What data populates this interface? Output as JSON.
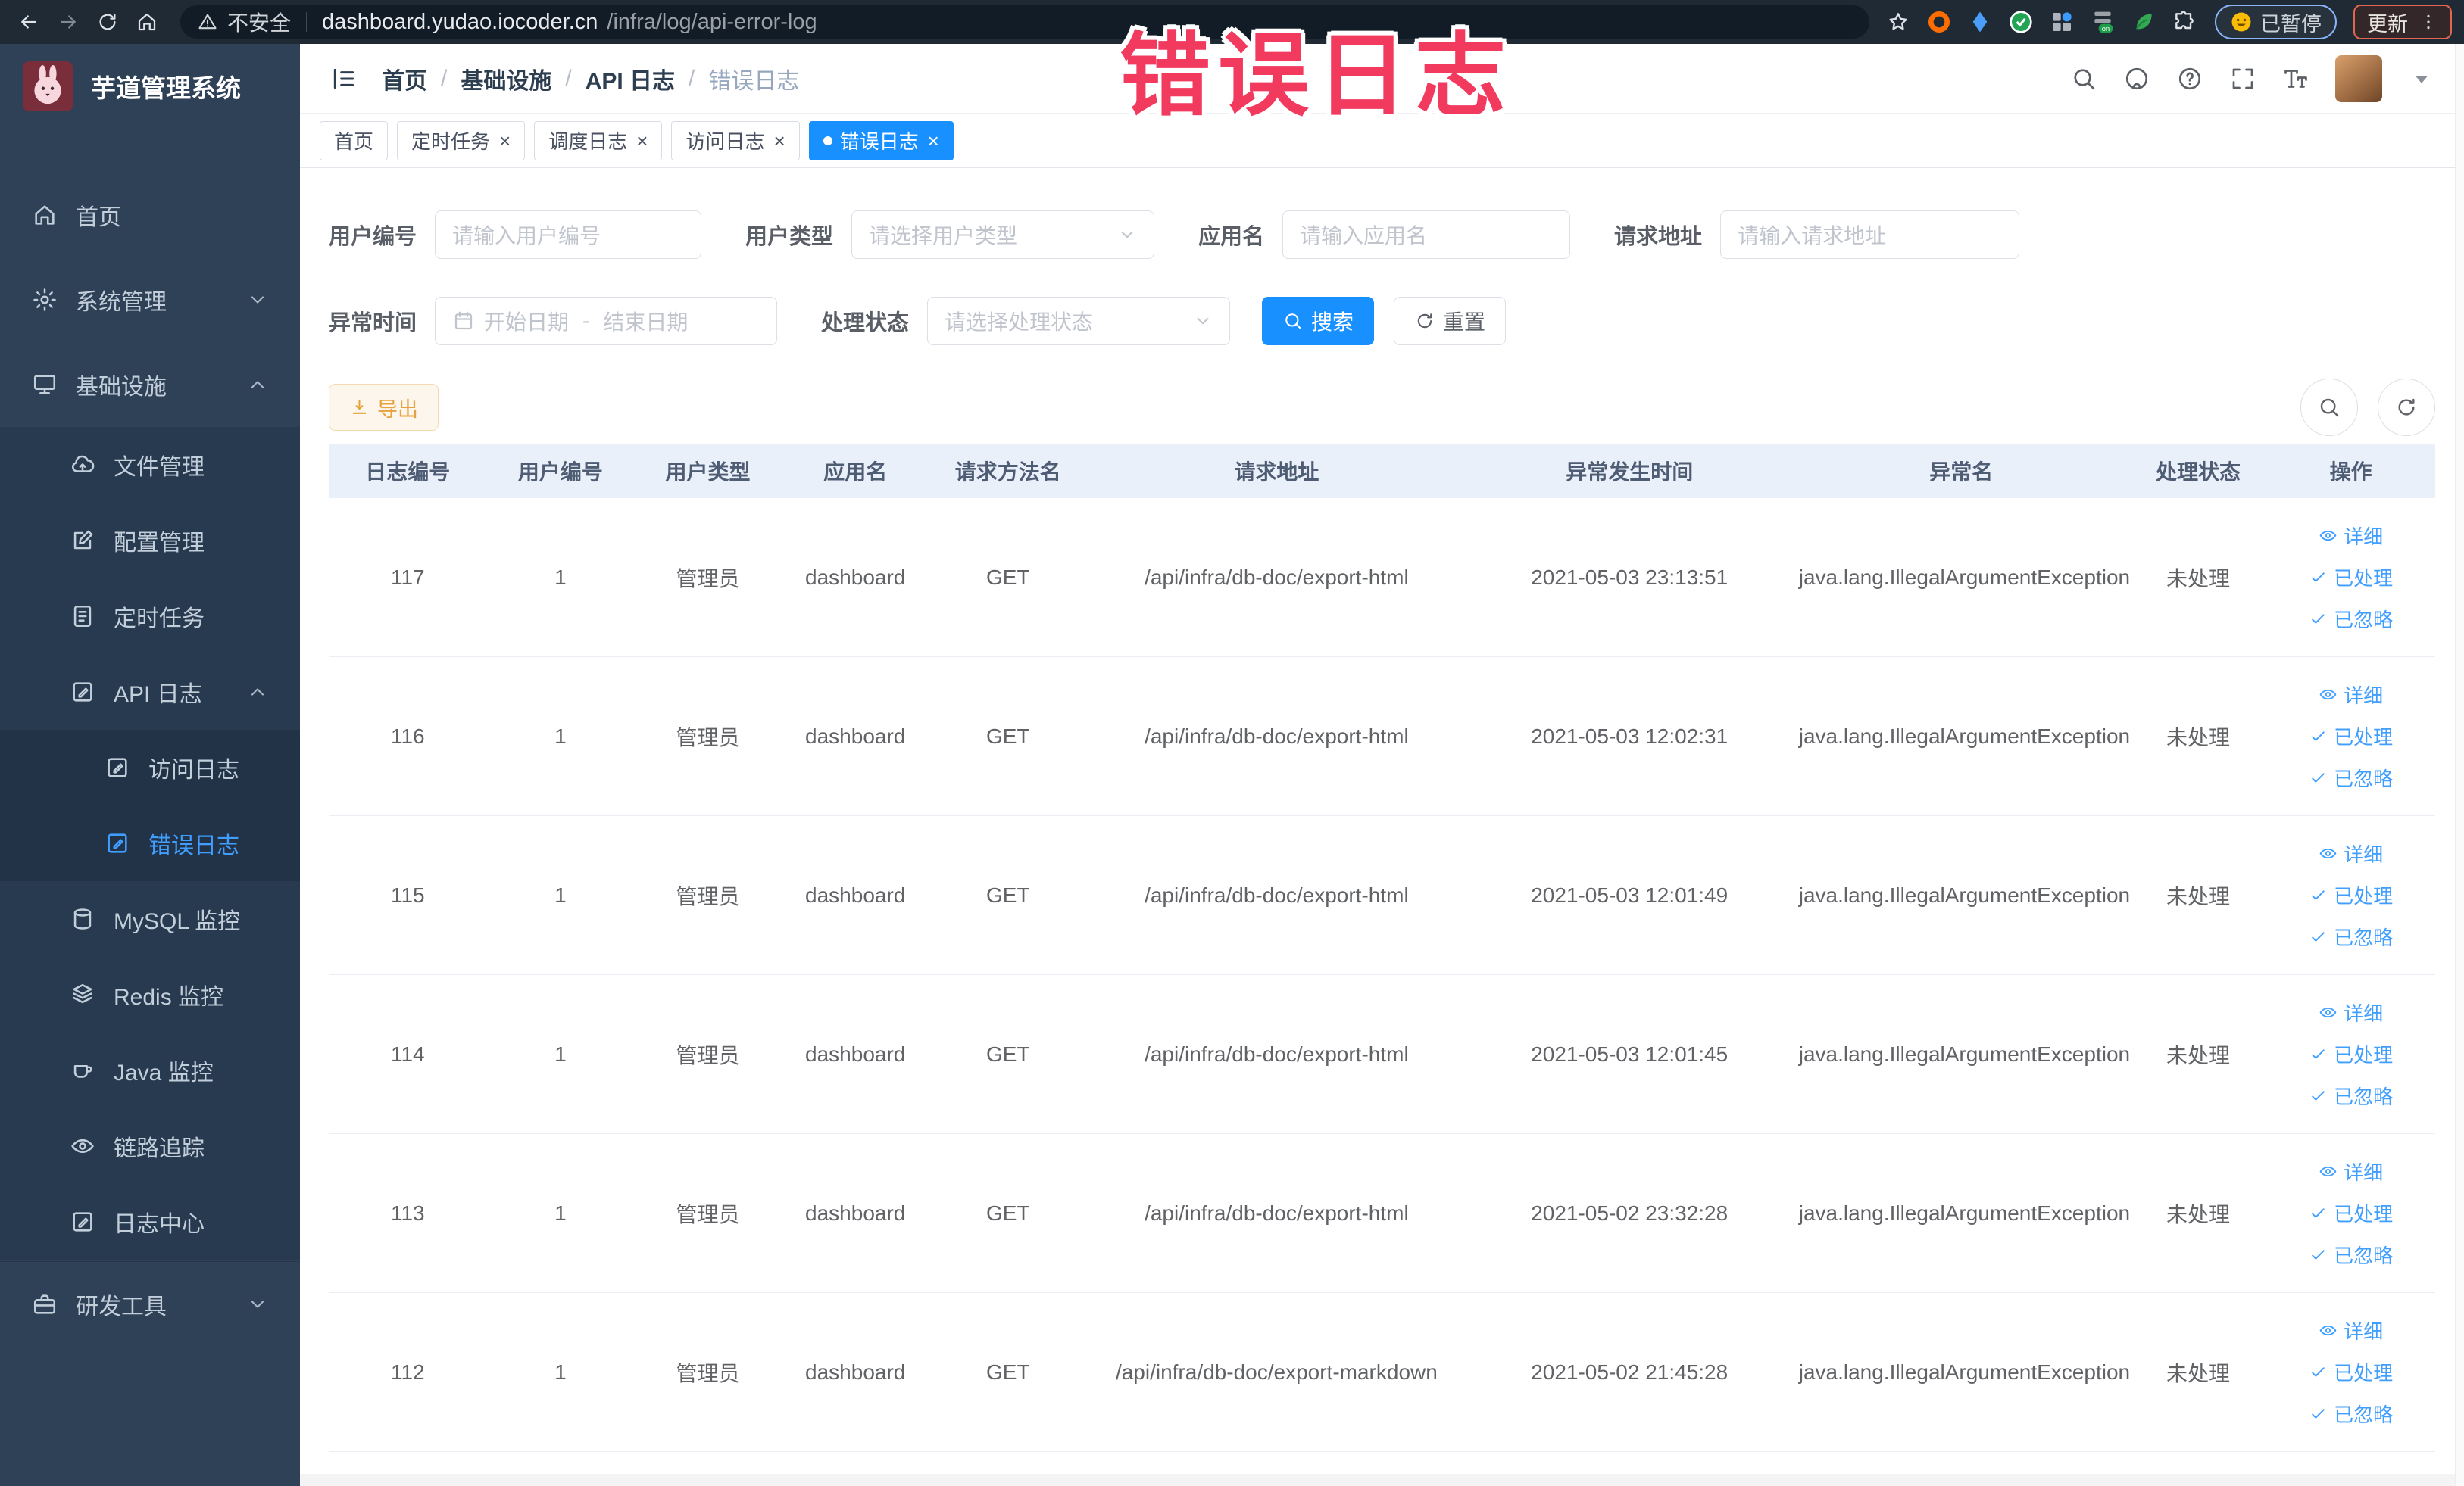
{
  "browser": {
    "security_label": "不安全",
    "url_host": "dashboard.yudao.iocoder.cn",
    "url_path": "/infra/log/api-error-log",
    "paused_label": "已暂停",
    "update_label": "更新"
  },
  "annotation": {
    "text": "错误日志"
  },
  "sidebar": {
    "title": "芋道管理系统",
    "items": [
      {
        "label": "首页",
        "lvl": "l1",
        "icon": "home",
        "chevron": "",
        "active": false,
        "bottom": false
      },
      {
        "label": "系统管理",
        "lvl": "l1",
        "icon": "gear",
        "chevron": "down",
        "active": false,
        "bottom": false
      },
      {
        "label": "基础设施",
        "lvl": "l1",
        "icon": "monitor",
        "chevron": "up",
        "active": false,
        "bottom": false
      },
      {
        "label": "文件管理",
        "lvl": "l2",
        "icon": "cloud",
        "chevron": "",
        "active": false,
        "bottom": false
      },
      {
        "label": "配置管理",
        "lvl": "l2",
        "icon": "edit",
        "chevron": "",
        "active": false,
        "bottom": false
      },
      {
        "label": "定时任务",
        "lvl": "l2",
        "icon": "todo",
        "chevron": "",
        "active": false,
        "bottom": false
      },
      {
        "label": "API 日志",
        "lvl": "l2",
        "icon": "logdoc",
        "chevron": "up",
        "active": false,
        "bottom": false
      },
      {
        "label": "访问日志",
        "lvl": "l3",
        "icon": "logdoc",
        "chevron": "",
        "active": false,
        "bottom": false
      },
      {
        "label": "错误日志",
        "lvl": "l3",
        "icon": "logdoc",
        "chevron": "",
        "active": true,
        "bottom": false
      },
      {
        "label": "MySQL 监控",
        "lvl": "l2",
        "icon": "db",
        "chevron": "",
        "active": false,
        "bottom": false
      },
      {
        "label": "Redis 监控",
        "lvl": "l2",
        "icon": "layers",
        "chevron": "",
        "active": false,
        "bottom": false
      },
      {
        "label": "Java 监控",
        "lvl": "l2",
        "icon": "coffee",
        "chevron": "",
        "active": false,
        "bottom": false
      },
      {
        "label": "链路追踪",
        "lvl": "l2",
        "icon": "eye",
        "chevron": "",
        "active": false,
        "bottom": false
      },
      {
        "label": "日志中心",
        "lvl": "l2",
        "icon": "logdoc",
        "chevron": "",
        "active": false,
        "bottom": false
      },
      {
        "label": "研发工具",
        "lvl": "l1",
        "icon": "briefcase",
        "chevron": "down",
        "active": false,
        "bottom": true
      }
    ]
  },
  "header": {
    "breadcrumb": [
      "首页",
      "基础设施",
      "API 日志",
      "错误日志"
    ]
  },
  "tabs": [
    {
      "label": "首页",
      "closable": false,
      "active": false
    },
    {
      "label": "定时任务",
      "closable": true,
      "active": false
    },
    {
      "label": "调度日志",
      "closable": true,
      "active": false
    },
    {
      "label": "访问日志",
      "closable": true,
      "active": false
    },
    {
      "label": "错误日志",
      "closable": true,
      "active": true
    }
  ],
  "filters": {
    "user_id_label": "用户编号",
    "user_id_placeholder": "请输入用户编号",
    "user_type_label": "用户类型",
    "user_type_placeholder": "请选择用户类型",
    "app_name_label": "应用名",
    "app_name_placeholder": "请输入应用名",
    "req_url_label": "请求地址",
    "req_url_placeholder": "请输入请求地址",
    "time_label": "异常时间",
    "time_start_placeholder": "开始日期",
    "time_separator": "-",
    "time_end_placeholder": "结束日期",
    "status_label": "处理状态",
    "status_placeholder": "请选择处理状态",
    "search_label": "搜索",
    "reset_label": "重置"
  },
  "toolbar": {
    "export_label": "导出"
  },
  "table": {
    "columns": [
      "日志编号",
      "用户编号",
      "用户类型",
      "应用名",
      "请求方法名",
      "请求地址",
      "异常发生时间",
      "异常名",
      "处理状态",
      "操作"
    ],
    "action_labels": {
      "detail": "详细",
      "processed": "已处理",
      "ignored": "已忽略"
    },
    "rows": [
      {
        "id": "117",
        "user_id": "1",
        "user_type": "管理员",
        "app": "dashboard",
        "method": "GET",
        "url": "/api/infra/db-doc/export-html",
        "time": "2021-05-03 23:13:51",
        "exception": "java.lang.IllegalArgumentException",
        "status": "未处理"
      },
      {
        "id": "116",
        "user_id": "1",
        "user_type": "管理员",
        "app": "dashboard",
        "method": "GET",
        "url": "/api/infra/db-doc/export-html",
        "time": "2021-05-03 12:02:31",
        "exception": "java.lang.IllegalArgumentException",
        "status": "未处理"
      },
      {
        "id": "115",
        "user_id": "1",
        "user_type": "管理员",
        "app": "dashboard",
        "method": "GET",
        "url": "/api/infra/db-doc/export-html",
        "time": "2021-05-03 12:01:49",
        "exception": "java.lang.IllegalArgumentException",
        "status": "未处理"
      },
      {
        "id": "114",
        "user_id": "1",
        "user_type": "管理员",
        "app": "dashboard",
        "method": "GET",
        "url": "/api/infra/db-doc/export-html",
        "time": "2021-05-03 12:01:45",
        "exception": "java.lang.IllegalArgumentException",
        "status": "未处理"
      },
      {
        "id": "113",
        "user_id": "1",
        "user_type": "管理员",
        "app": "dashboard",
        "method": "GET",
        "url": "/api/infra/db-doc/export-html",
        "time": "2021-05-02 23:32:28",
        "exception": "java.lang.IllegalArgumentException",
        "status": "未处理"
      },
      {
        "id": "112",
        "user_id": "1",
        "user_type": "管理员",
        "app": "dashboard",
        "method": "GET",
        "url": "/api/infra/db-doc/export-markdown",
        "time": "2021-05-02 21:45:28",
        "exception": "java.lang.IllegalArgumentException",
        "status": "未处理"
      }
    ]
  },
  "colors": {
    "primary": "#1890ff",
    "link": "#409eff",
    "warning": "#e6a23c",
    "sidebar_bg": "#2f4156",
    "annotation": "#f23a5f"
  }
}
